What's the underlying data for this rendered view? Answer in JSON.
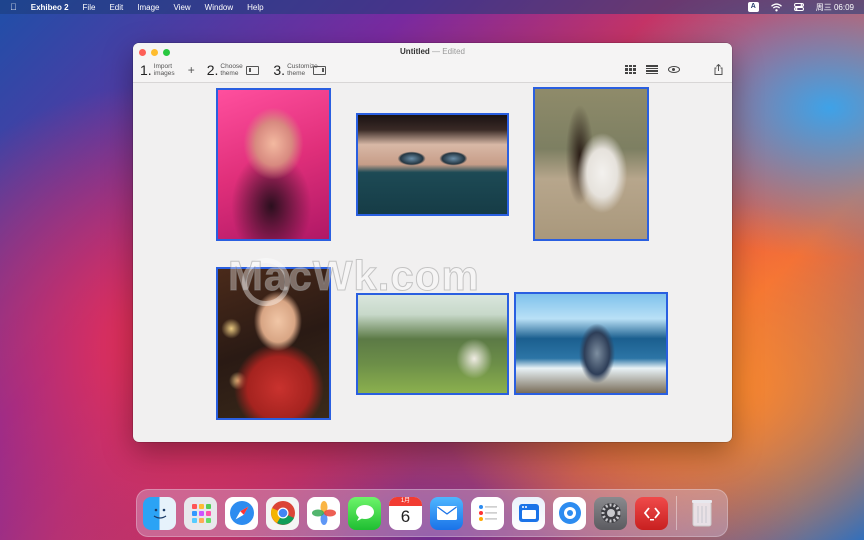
{
  "menubar": {
    "app_name": "Exhibeo 2",
    "menus": [
      "File",
      "Edit",
      "Image",
      "View",
      "Window",
      "Help"
    ],
    "input_source": "A",
    "clock": "周三 06:09"
  },
  "window": {
    "title": "Untitled",
    "title_separator": "—",
    "status": "Edited",
    "steps": [
      {
        "num": "1.",
        "label": "Import images"
      },
      {
        "num": "2.",
        "label": "Choose theme"
      },
      {
        "num": "3.",
        "label": "Customize theme"
      }
    ],
    "add_label": "+"
  },
  "canvas": {
    "photos": [
      {
        "name": "woman-pink-neon"
      },
      {
        "name": "woman-eyes-scarf"
      },
      {
        "name": "woman-sitting-beach"
      },
      {
        "name": "girl-red-sweater-lights"
      },
      {
        "name": "woman-reading-meadow"
      },
      {
        "name": "woman-sea-cliffs"
      }
    ],
    "watermark": "MacWk.com"
  },
  "dock": {
    "apps": [
      "Finder",
      "Launchpad",
      "Safari",
      "Chrome",
      "Photos",
      "Messages",
      "Calendar",
      "Mail",
      "Reminders",
      "App Store",
      "Music",
      "System Preferences",
      "Exhibeo",
      "Trash"
    ],
    "calendar_month": "1月",
    "calendar_day": "6"
  },
  "colors": {
    "selection_border": "#2a5fe0",
    "close": "#fd5f57",
    "minimize": "#febc2e",
    "maximize": "#28c840"
  }
}
